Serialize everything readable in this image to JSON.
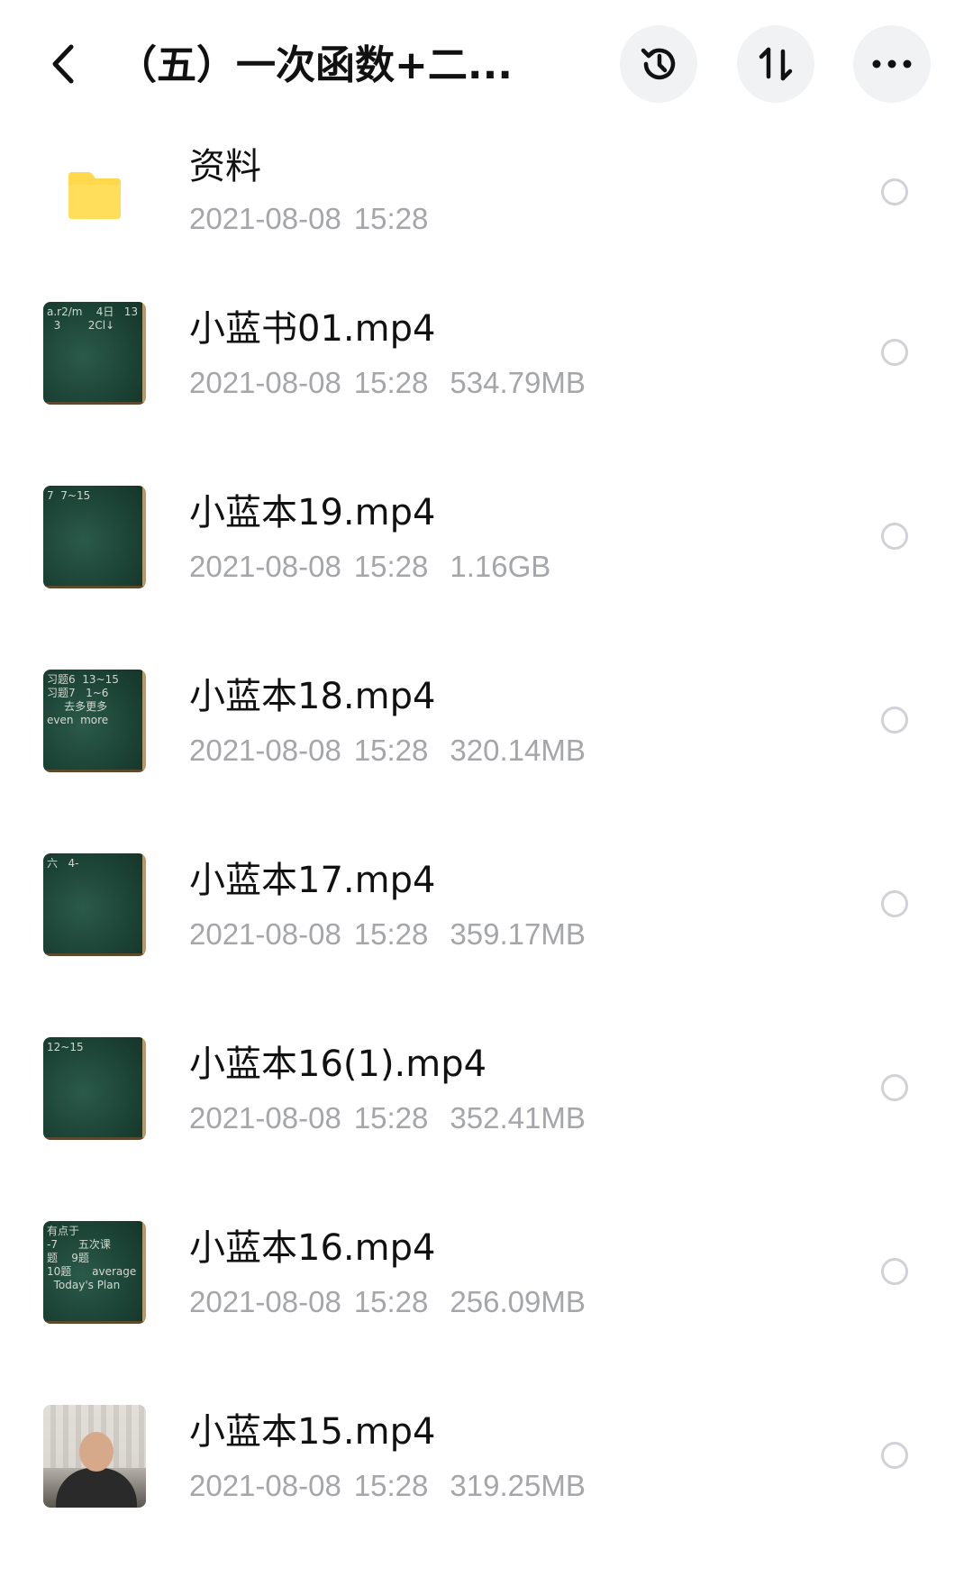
{
  "header": {
    "title": "（五）一次函数+二...",
    "back_icon": "chevron-left-icon",
    "history_icon": "history-clock-icon",
    "sort_icon": "sort-arrows-icon",
    "more_icon": "more-dots-icon"
  },
  "items": [
    {
      "type": "folder",
      "name": "资料",
      "date": "2021-08-08",
      "time": "15:28",
      "size": "",
      "thumb_icon": "folder-icon",
      "thumb_color": "#FFD84D"
    },
    {
      "type": "video",
      "name": "小蓝书01.mp4",
      "date": "2021-08-08",
      "time": "15:28",
      "size": "534.79MB",
      "thumb_icon": "chalkboard-thumbnail"
    },
    {
      "type": "video",
      "name": "小蓝本19.mp4",
      "date": "2021-08-08",
      "time": "15:28",
      "size": "1.16GB",
      "thumb_icon": "chalkboard-thumbnail"
    },
    {
      "type": "video",
      "name": "小蓝本18.mp4",
      "date": "2021-08-08",
      "time": "15:28",
      "size": "320.14MB",
      "thumb_icon": "chalkboard-thumbnail"
    },
    {
      "type": "video",
      "name": "小蓝本17.mp4",
      "date": "2021-08-08",
      "time": "15:28",
      "size": "359.17MB",
      "thumb_icon": "chalkboard-thumbnail"
    },
    {
      "type": "video",
      "name": "小蓝本16(1).mp4",
      "date": "2021-08-08",
      "time": "15:28",
      "size": "352.41MB",
      "thumb_icon": "chalkboard-thumbnail"
    },
    {
      "type": "video",
      "name": "小蓝本16.mp4",
      "date": "2021-08-08",
      "time": "15:28",
      "size": "256.09MB",
      "thumb_icon": "chalkboard-thumbnail"
    },
    {
      "type": "video",
      "name": "小蓝本15.mp4",
      "date": "2021-08-08",
      "time": "15:28",
      "size": "319.25MB",
      "thumb_icon": "person-photo-thumbnail"
    }
  ]
}
